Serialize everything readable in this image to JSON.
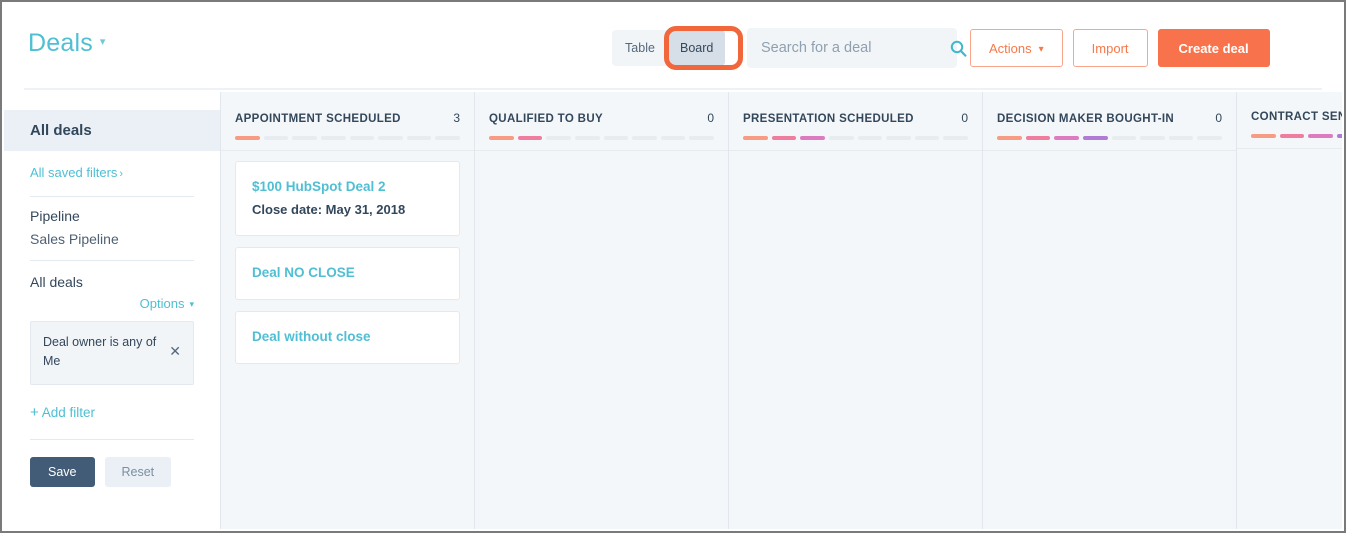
{
  "header": {
    "title": "Deals",
    "title_caret": "▾",
    "view_toggle": [
      {
        "label": "Table",
        "active": false
      },
      {
        "label": "Board",
        "active": true
      }
    ],
    "search": {
      "placeholder": "Search for a deal",
      "value": "",
      "icon": "search-icon"
    },
    "buttons": [
      {
        "label": "Actions",
        "caret": "▾",
        "style": "secondary"
      },
      {
        "label": "Import",
        "caret": "",
        "style": "secondary"
      },
      {
        "label": "Create deal",
        "caret": "",
        "style": "primary"
      }
    ],
    "annotation": {
      "target": "Board",
      "color": "#f2663c"
    }
  },
  "sidebar": {
    "selected_view": "All deals",
    "saved_filters_link": "All saved filters",
    "saved_filters_chevron": "›",
    "pipeline_label": "Pipeline",
    "pipeline_value": "Sales Pipeline",
    "filter_set_label": "All deals",
    "options_label": "Options",
    "options_caret": "▾",
    "filter_chip": {
      "text": "Deal owner is any of Me",
      "line1": "Deal owner is any of",
      "line2": "Me",
      "close": "✕"
    },
    "add_filter_label": "Add filter",
    "add_filter_plus": "+",
    "save_label": "Save",
    "reset_label": "Reset"
  },
  "board": {
    "stage_colors": [
      "#f79b82",
      "#ef7d9d",
      "#dd7bc0",
      "#b07bd4",
      "#9a85d8",
      "#7f92dd",
      "#6fa8df",
      "#5fb6d8"
    ],
    "empty_segment_color": "#e6ecf0",
    "segment_total": 8,
    "columns": [
      {
        "title": "APPOINTMENT SCHEDULED",
        "count": "3",
        "filled_segments": 1,
        "cards": [
          {
            "title": "$100 HubSpot Deal 2",
            "subtitle": "Close date: May 31, 2018"
          },
          {
            "title": "Deal NO CLOSE",
            "subtitle": ""
          },
          {
            "title": "Deal without close",
            "subtitle": ""
          }
        ]
      },
      {
        "title": "QUALIFIED TO BUY",
        "count": "0",
        "filled_segments": 2,
        "cards": []
      },
      {
        "title": "PRESENTATION SCHEDULED",
        "count": "0",
        "filled_segments": 3,
        "cards": []
      },
      {
        "title": "DECISION MAKER BOUGHT-IN",
        "count": "0",
        "filled_segments": 4,
        "cards": []
      },
      {
        "title": "CONTRACT SENT",
        "count": "",
        "filled_segments": 5,
        "cards": []
      }
    ]
  }
}
